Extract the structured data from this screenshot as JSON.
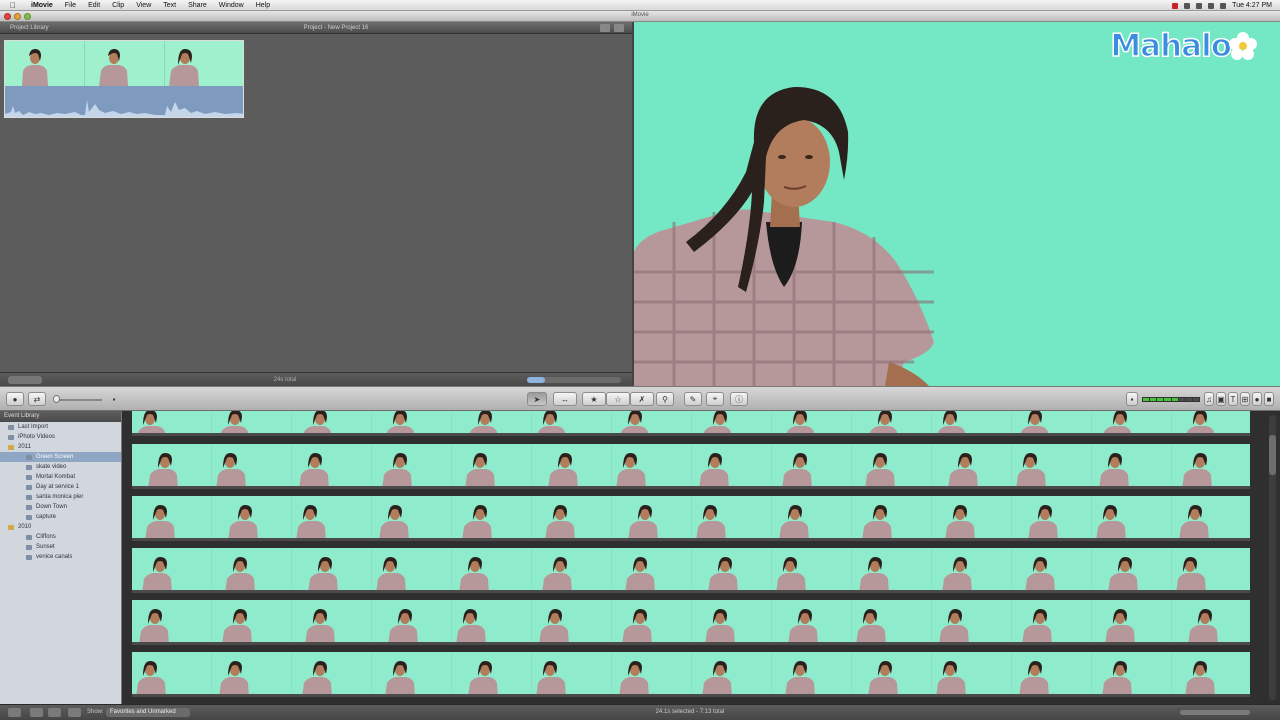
{
  "menubar": {
    "app_name": "iMovie",
    "items": [
      "File",
      "Edit",
      "Clip",
      "View",
      "Text",
      "Share",
      "Window",
      "Help"
    ],
    "clock": "Tue 4:27 PM"
  },
  "window": {
    "title": "iMovie"
  },
  "project_library": {
    "header_label": "Project Library",
    "project_title": "Project - New Project 16",
    "footer_total": "24s total"
  },
  "logo": {
    "text": "Mahalo"
  },
  "event_library": {
    "header_label": "Event Library",
    "items": [
      {
        "label": "Last Import",
        "level": 0,
        "icon": "clip"
      },
      {
        "label": "iPhoto Videos",
        "level": 0,
        "icon": "clip"
      },
      {
        "label": "2011",
        "level": 0,
        "icon": "folder"
      },
      {
        "label": "Green Screen",
        "level": 1,
        "icon": "clip",
        "selected": true
      },
      {
        "label": "skate video",
        "level": 1,
        "icon": "clip"
      },
      {
        "label": "Mortal Kombat",
        "level": 1,
        "icon": "clip"
      },
      {
        "label": "Day at service 1",
        "level": 1,
        "icon": "clip"
      },
      {
        "label": "santa monica pier",
        "level": 1,
        "icon": "clip"
      },
      {
        "label": "Down Town",
        "level": 1,
        "icon": "clip"
      },
      {
        "label": "capture",
        "level": 1,
        "icon": "clip"
      },
      {
        "label": "2010",
        "level": 0,
        "icon": "folder"
      },
      {
        "label": "Cliffons",
        "level": 1,
        "icon": "clip"
      },
      {
        "label": "Sunset",
        "level": 1,
        "icon": "clip"
      },
      {
        "label": "venice canals",
        "level": 1,
        "icon": "clip"
      }
    ]
  },
  "bottom_bar": {
    "show_label": "Show:",
    "show_value": "Favorites and Unmarked",
    "status": "24.1s selected - 7:13 total"
  },
  "colors": {
    "green_screen": "#74e7c4",
    "shirt": "#b7989a",
    "hair": "#2b211c",
    "skin": "#b27d5c",
    "waveform": "#7e9bbf",
    "selection": "#8fa6c4"
  },
  "icons": [
    "apple-icon",
    "camera-icon",
    "arrow-icon",
    "star-icon",
    "reject-icon",
    "crop-icon",
    "info-icon",
    "voiceover-icon",
    "music-icon"
  ]
}
